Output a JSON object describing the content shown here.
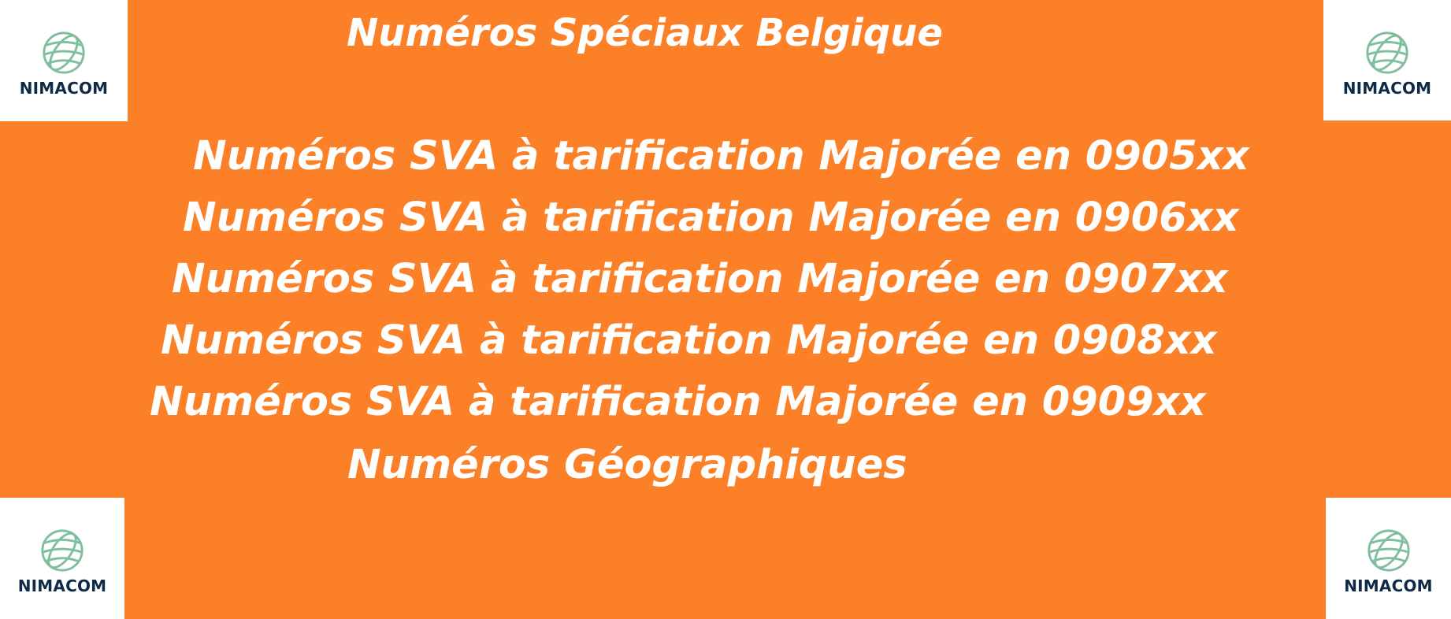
{
  "logos": {
    "text": "NIMACOM",
    "icon": "globe-icon",
    "icon_color": "#7FBF9E",
    "text_color": "#0E2A47"
  },
  "banner": {
    "background_color": "#FC8027",
    "text_color": "#FFFFFF"
  },
  "heading": "Numéros Spéciaux Belgique",
  "sva_lines": [
    "Numéros SVA à tarification Majorée en 0905xx",
    "Numéros SVA à tarification Majorée en 0906xx",
    "Numéros SVA à tarification Majorée en 0907xx",
    "Numéros SVA à tarification Majorée en 0908xx",
    "Numéros SVA à tarification Majorée en 0909xx"
  ],
  "geographic_line": "Numéros Géographiques"
}
